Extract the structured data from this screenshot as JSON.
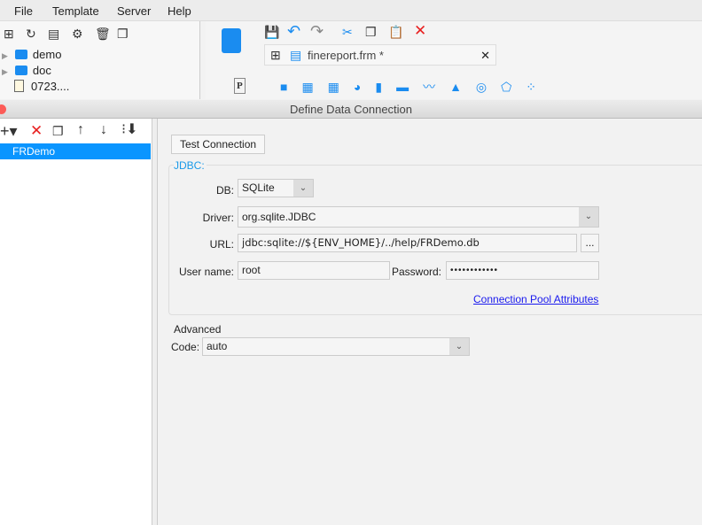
{
  "menu": [
    "File",
    "Template",
    "Server",
    "Help"
  ],
  "tree": {
    "items": [
      {
        "label": "demo",
        "type": "folder"
      },
      {
        "label": "doc",
        "type": "folder"
      },
      {
        "label": "0723....",
        "type": "file"
      }
    ]
  },
  "tab": {
    "label": "finereport.frm *"
  },
  "dialog": {
    "title": "Define Data Connection",
    "connections": [
      "FRDemo"
    ],
    "test_button": "Test Connection",
    "jdbc_legend": "JDBC:",
    "db_label": "DB:",
    "db_value": "SQLite",
    "driver_label": "Driver:",
    "driver_value": "org.sqlite.JDBC",
    "url_label": "URL:",
    "url_value": "jdbc:sqlite://${ENV_HOME}/../help/FRDemo.db",
    "url_browse": "...",
    "user_label": "User name:",
    "user_value": "root",
    "password_label": "Password:",
    "password_value": "••••••••••••",
    "pool_link": "Connection Pool Attributes",
    "advanced_label": "Advanced",
    "code_label": "Code:",
    "code_value": "auto"
  },
  "colors": {
    "accent": "#0a95ff",
    "link": "#1a1aee",
    "legend": "#1a9ae8"
  }
}
